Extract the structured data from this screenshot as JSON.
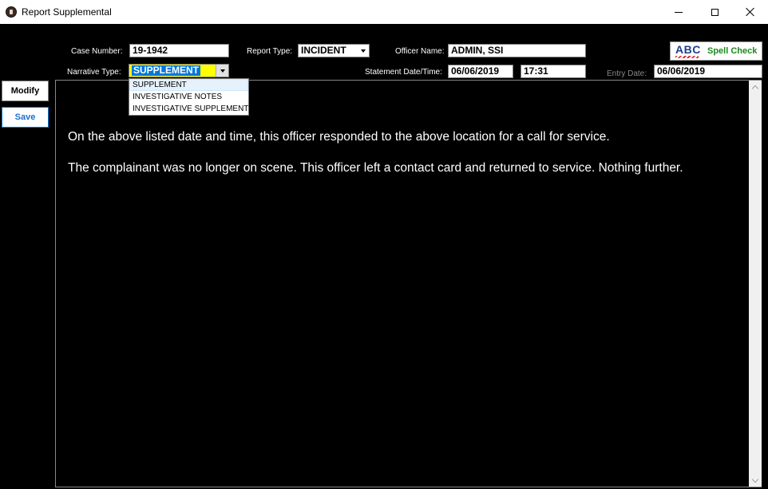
{
  "window": {
    "title": "Report Supplemental"
  },
  "form": {
    "case_number_label": "Case Number:",
    "case_number": "19-1942",
    "report_type_label": "Report Type:",
    "report_type": "INCIDENT",
    "officer_name_label": "Officer Name:",
    "officer_name": "ADMIN, SSI",
    "narrative_type_label": "Narrative Type:",
    "narrative_type": "SUPPLEMENT",
    "narrative_type_highlight_color": "#ffff00",
    "narrative_type_selection_color": "#0078d7",
    "statement_datetime_label": "Statement Date/Time:",
    "statement_date": "06/06/2019",
    "statement_time": "17:31",
    "entry_date_label": "Entry Date:",
    "entry_date": "06/06/2019"
  },
  "spell_check": {
    "icon_text": "ABC",
    "label": "Spell Check"
  },
  "buttons": {
    "modify": "Modify",
    "save": "Save"
  },
  "narrative_dropdown": {
    "options": [
      "SUPPLEMENT",
      "INVESTIGATIVE NOTES",
      "INVESTIGATIVE SUPPLEMENT"
    ]
  },
  "narrative": {
    "paragraphs": [
      "On the above listed date and time, this officer responded to the above location for a call for service.",
      "The complainant was no longer on scene.  This officer left a contact card and returned to service.  Nothing further."
    ]
  },
  "colors": {
    "background": "#000000",
    "spell_check_text": "#1a8a1a",
    "save_text": "#1a6fd0"
  }
}
